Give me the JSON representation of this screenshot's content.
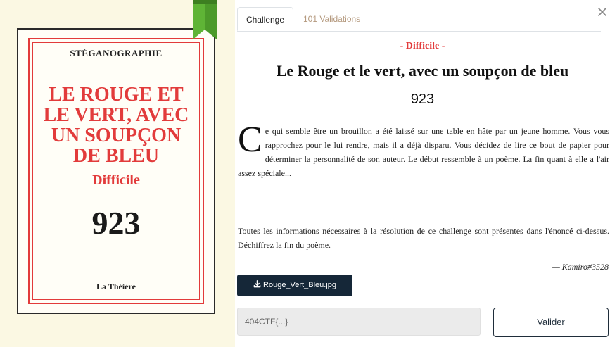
{
  "cover": {
    "category": "STÉGANOGRAPHIE",
    "title_lines": [
      "LE ROUGE ET",
      "LE VERT, AVEC",
      "UN SOUPÇON",
      "DE BLEU"
    ],
    "difficulty": "Difficile",
    "points": "923",
    "publisher": "La Théière"
  },
  "tabs": {
    "challenge": "Challenge",
    "validations": "101 Validations"
  },
  "challenge": {
    "difficulty": "- Difficile -",
    "title": "Le Rouge et le vert, avec un soupçon de bleu",
    "points": "923",
    "description_dropcap": "C",
    "description_rest": "e qui semble être un brouillon a été laissé sur une table en hâte par un jeune homme. Vous vous rapprochez pour le lui rendre, mais il a déjà disparu. Vous décidez de lire ce bout de papier pour déterminer la personnalité de son auteur. Le début ressemble à un poème. La fin quant à elle a l'air assez spéciale...",
    "instructions": "Toutes les informations nécessaires à la résolution de ce challenge sont présentes dans l'énoncé ci-dessus. Déchiffrez la fin du poème.",
    "author": "— Kamiro#3528",
    "attachment_label": "Rouge_Vert_Bleu.jpg"
  },
  "form": {
    "flag_placeholder": "404CTF{...}",
    "flag_value": "",
    "submit_label": "Valider"
  },
  "colors": {
    "accent_red": "#e23b3b",
    "navy": "#152738",
    "ribbon_green": "#4c9a2a",
    "cover_bg": "#fbf8e3"
  },
  "icons": {
    "close": "close-icon",
    "download": "download-icon",
    "ribbon": "bookmark-ribbon-icon"
  }
}
